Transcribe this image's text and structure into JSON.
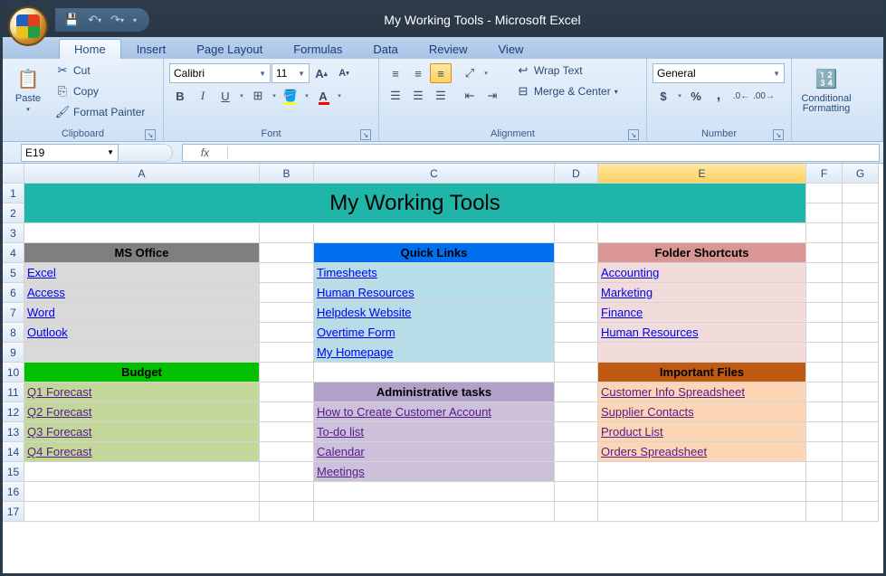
{
  "window": {
    "title": "My Working Tools - Microsoft Excel"
  },
  "tabs": {
    "home": "Home",
    "insert": "Insert",
    "page_layout": "Page Layout",
    "formulas": "Formulas",
    "data": "Data",
    "review": "Review",
    "view": "View"
  },
  "ribbon": {
    "clipboard": {
      "paste": "Paste",
      "cut": "Cut",
      "copy": "Copy",
      "format_painter": "Format Painter",
      "label": "Clipboard"
    },
    "font": {
      "name": "Calibri",
      "size": "11",
      "label": "Font"
    },
    "alignment": {
      "wrap": "Wrap Text",
      "merge": "Merge & Center",
      "label": "Alignment"
    },
    "number": {
      "format": "General",
      "label": "Number"
    },
    "styles": {
      "cond": "Conditional Formatting"
    }
  },
  "formula_bar": {
    "cell_ref": "E19",
    "fx": "fx",
    "value": ""
  },
  "columns": [
    "A",
    "B",
    "C",
    "D",
    "E",
    "F",
    "G"
  ],
  "sheet": {
    "title": "My Working Tools",
    "ms_office": {
      "header": "MS Office",
      "links": [
        "Excel",
        "Access",
        "Word",
        "Outlook"
      ]
    },
    "budget": {
      "header": "Budget",
      "links": [
        "Q1 Forecast",
        "Q2 Forecast",
        "Q3 Forecast",
        "Q4 Forecast"
      ]
    },
    "quick_links": {
      "header": "Quick Links",
      "links": [
        "Timesheets",
        "Human Resources",
        "Helpdesk Website",
        "Overtime Form",
        "My Homepage"
      ]
    },
    "admin": {
      "header": "Administrative tasks",
      "links": [
        "How to Create Customer Account",
        "To-do list",
        "Calendar",
        "Meetings"
      ]
    },
    "folders": {
      "header": "Folder Shortcuts",
      "links": [
        "Accounting",
        "Marketing",
        "Finance",
        "Human Resources"
      ]
    },
    "important": {
      "header": "Important Files",
      "links": [
        "Customer Info Spreadsheet",
        "Supplier Contacts",
        "Product List",
        "Orders Spreadsheet"
      ]
    }
  }
}
